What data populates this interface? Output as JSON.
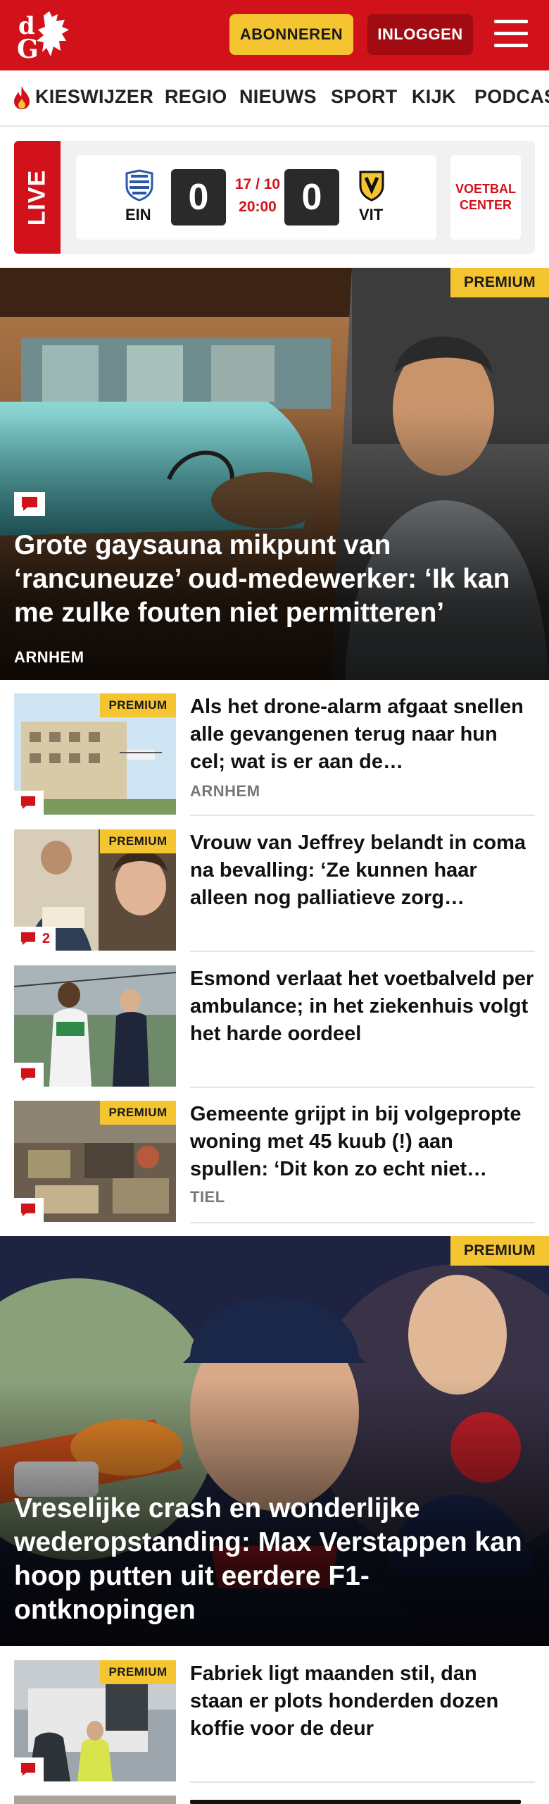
{
  "header": {
    "logo_text": "dG",
    "subscribe_label": "ABONNEREN",
    "login_label": "INLOGGEN",
    "brand_color": "#d1121b",
    "accent_color": "#f5c431"
  },
  "nav": {
    "items": [
      "KIESWIJZER",
      "REGIO",
      "NIEUWS",
      "SPORT",
      "KIJK",
      "PODCAS"
    ]
  },
  "live": {
    "label": "LIVE",
    "home_team": "EIN",
    "away_team": "VIT",
    "home_score": "0",
    "away_score": "0",
    "date": "17 / 10",
    "time": "20:00",
    "voetbal_center": "VOETBAL CENTER"
  },
  "hero1": {
    "badge": "PREMIUM",
    "title": "Grote gaysauna mikpunt van ‘rancuneuze’ oud-medewerker: ‘Ik kan me zulke fouten niet permitteren’",
    "location": "ARNHEM"
  },
  "articles": [
    {
      "premium": "PREMIUM",
      "title": "Als het drone-alarm afgaat snellen alle gevangenen terug naar hun cel; wat is er aan de…",
      "location": "ARNHEM",
      "comments": ""
    },
    {
      "premium": "PREMIUM",
      "title": "Vrouw van Jeffrey belandt in coma na bevalling: ‘Ze kunnen haar alleen nog palliatieve zorg…",
      "location": "",
      "comments": "2"
    },
    {
      "premium": "",
      "title": "Esmond verlaat het voetbalveld per ambulance; in het ziekenhuis volgt het harde oordeel",
      "location": "",
      "comments": ""
    },
    {
      "premium": "PREMIUM",
      "title": "Gemeente grijpt in bij volgeprop­te woning met 45 kuub (!) aan spullen: ‘Dit kon zo echt niet…",
      "location": "TIEL",
      "comments": ""
    }
  ],
  "hero2": {
    "badge": "PREMIUM",
    "title": "Vreselijke crash en wonderlijke wederopstanding: Max Verstappen kan hoop putten uit eerdere F1-ontknopingen"
  },
  "article5": {
    "premium": "PREMIUM",
    "title": "Fabriek ligt maanden stil, dan staan er plots honderden dozen koffie voor de deur",
    "location": "",
    "comments": ""
  }
}
